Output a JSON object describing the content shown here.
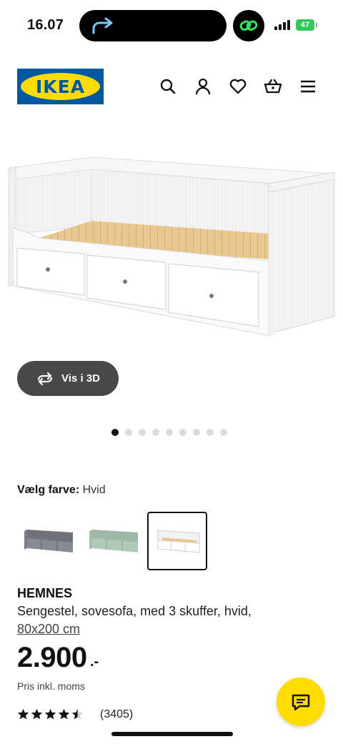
{
  "status_bar": {
    "time": "16.07",
    "battery": "47"
  },
  "header": {
    "logo_text": "IKEA",
    "icons": [
      "search-icon",
      "account-icon",
      "heart-icon",
      "cart-icon",
      "menu-icon"
    ]
  },
  "gallery": {
    "view_3d_label": "Vis i 3D",
    "image_count": 9,
    "active_index": 0
  },
  "color": {
    "label": "Vælg farve:",
    "selected": "Hvid",
    "options": [
      "grey",
      "green",
      "white"
    ]
  },
  "product": {
    "name": "HEMNES",
    "description": "Sengestel, sovesofa, med 3 skuffer, hvid,",
    "size": "80x200 cm",
    "price": "2.900",
    "price_suffix": ".-",
    "vat_note": "Pris inkl. moms",
    "rating": 4.5,
    "review_count": "(3405)"
  },
  "colors": {
    "brand_blue": "#0058a3",
    "brand_yellow": "#ffdb00",
    "dark_button": "#484848",
    "battery_green": "#35c759"
  }
}
